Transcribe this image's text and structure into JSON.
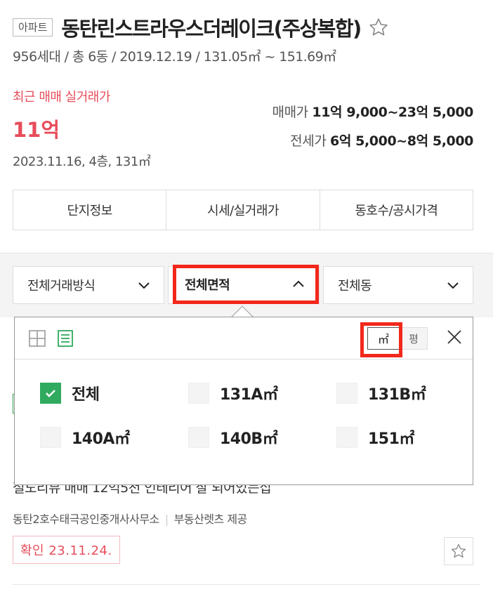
{
  "complex": {
    "type_badge": "아파트",
    "name": "동탄린스트라우스더레이크(주상복합)",
    "summary": "956세대 / 총 6동 / 2019.12.19 / 131.05㎡ ~ 151.69㎡"
  },
  "recent_trade": {
    "label": "최근 매매 실거래가",
    "price": "11억",
    "detail": "2023.11.16, 4층, 131㎡"
  },
  "prices": {
    "sale_label": "매매가",
    "sale_value": "11억 9,000~23억 5,000",
    "jeonse_label": "전세가",
    "jeonse_value": "6억 5,000~8억 5,000"
  },
  "tabs": [
    "단지정보",
    "시세/실거래가",
    "동호수/공시가격"
  ],
  "filters": {
    "trade_type": "전체거래방식",
    "area": "전체면적",
    "dong": "전체동"
  },
  "area_dropdown": {
    "unit_m2": "㎡",
    "unit_pyeong": "평",
    "selected_unit": "m2",
    "options": [
      {
        "label": "전체",
        "checked": true
      },
      {
        "label": "131A㎡",
        "checked": false
      },
      {
        "label": "131B㎡",
        "checked": false
      },
      {
        "label": "140A㎡",
        "checked": false
      },
      {
        "label": "140B㎡",
        "checked": false
      },
      {
        "label": "151㎡",
        "checked": false
      }
    ]
  },
  "listing": {
    "title": "철도리뷰 매매 12억5천 인테리어 잘 되어있는집",
    "agency": "동탄2호수태극공인중개사사무소",
    "provider": "부동산렛츠 제공",
    "confirmed": "확인 23.11.24."
  },
  "colors": {
    "accent_red": "#e74c5a",
    "highlight_red": "#f2281b",
    "check_green": "#2faa5e"
  }
}
